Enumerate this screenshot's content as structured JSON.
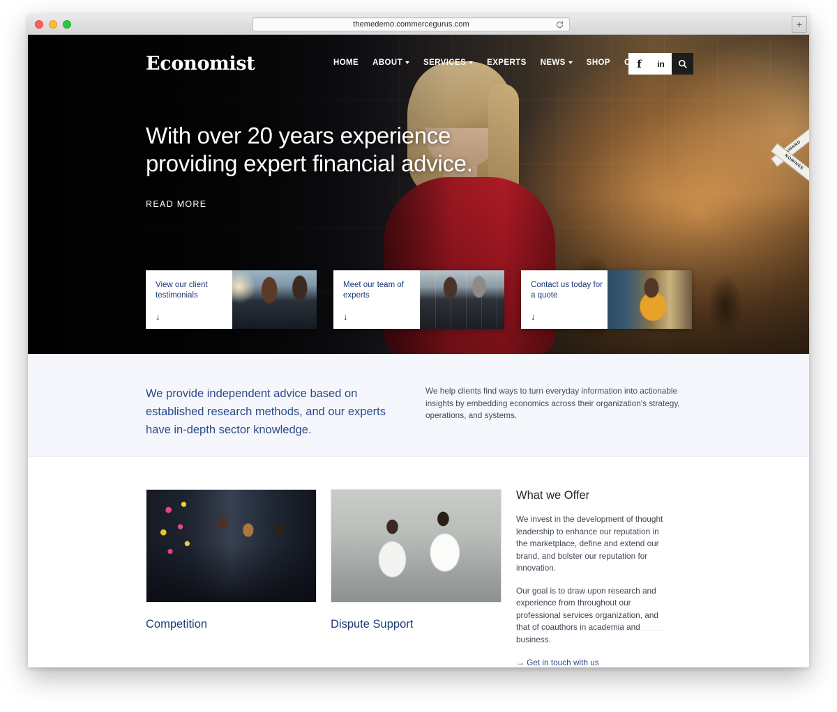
{
  "browser": {
    "url": "themedemo.commercegurus.com",
    "reload_icon": "reload-icon",
    "new_tab_label": "+",
    "traffic_lights": [
      "close",
      "minimize",
      "maximize"
    ]
  },
  "header": {
    "logo": "Economist",
    "nav": [
      {
        "label": "HOME",
        "has_dropdown": false
      },
      {
        "label": "ABOUT",
        "has_dropdown": true
      },
      {
        "label": "SERVICES",
        "has_dropdown": true
      },
      {
        "label": "EXPERTS",
        "has_dropdown": false
      },
      {
        "label": "NEWS",
        "has_dropdown": true
      },
      {
        "label": "SHOP",
        "has_dropdown": false
      },
      {
        "label": "CONTACT",
        "has_dropdown": false
      }
    ],
    "social": [
      {
        "name": "facebook",
        "glyph": "f"
      },
      {
        "name": "linkedin",
        "glyph": "in"
      }
    ],
    "search_icon": "search-icon"
  },
  "hero": {
    "headline": "With over 20 years experience providing expert financial advice.",
    "cta": "READ MORE",
    "award_badge": {
      "line1": "AWARD",
      "line2": "NOMINEE"
    },
    "cards": [
      {
        "title": "View our client testimonials",
        "arrow": "↓"
      },
      {
        "title": "Meet our team of experts",
        "arrow": "↓"
      },
      {
        "title": "Contact us today for a quote",
        "arrow": "↓"
      }
    ]
  },
  "intro": {
    "lead": "We provide independent advice based on established research methods, and our experts have in-depth sector knowledge.",
    "body": "We help clients find ways to turn everyday information into actionable insights by embedding economics across their organization's strategy, operations, and systems."
  },
  "offer": {
    "cards": [
      {
        "caption": "Competition"
      },
      {
        "caption": "Dispute Support"
      }
    ],
    "heading": "What we Offer",
    "paragraphs": [
      "We invest in the development of thought leadership to enhance our reputation in the marketplace, define and extend our brand, and bolster our reputation for innovation.",
      "Our goal is to draw upon research and experience from throughout our professional services organization, and that of coauthors in academia and business."
    ],
    "link": "→ Get in touch with us"
  },
  "colors": {
    "brand_navy": "#1d3a77",
    "intro_blue": "#2b4a8b",
    "intro_bg": "#f6f7fc",
    "hero_dress_red": "#a71722",
    "header_dark": "#1d1d1d"
  }
}
